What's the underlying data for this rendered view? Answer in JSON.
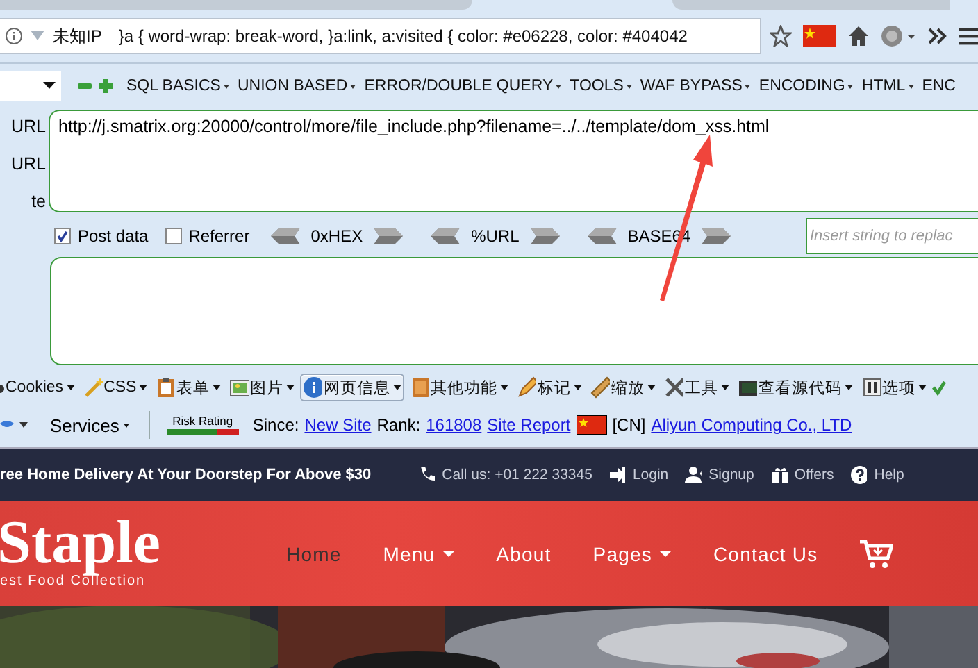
{
  "browser": {
    "ip_label": "未知IP",
    "address_text": "}a { word-wrap: break-word, }a:link, a:visited { color: #e06228, color: #404042"
  },
  "hackbar": {
    "menus": [
      {
        "label": "SQL BASICS",
        "has_menu": true
      },
      {
        "label": "UNION BASED",
        "has_menu": true
      },
      {
        "label": "ERROR/DOUBLE QUERY",
        "has_menu": true
      },
      {
        "label": "TOOLS",
        "has_menu": true
      },
      {
        "label": "WAF BYPASS",
        "has_menu": true
      },
      {
        "label": "ENCODING",
        "has_menu": true
      },
      {
        "label": "HTML",
        "has_menu": true
      },
      {
        "label": "ENC",
        "has_menu": false
      }
    ],
    "side_buttons": [
      "URL",
      "URL",
      "te"
    ],
    "url": "http://j.smatrix.org:20000/control/more/file_include.php?filename=../../template/dom_xss.html",
    "options": [
      {
        "label": "Post data",
        "checked": true
      },
      {
        "label": "Referrer",
        "checked": false
      }
    ],
    "encoders": [
      "0xHEX",
      "%URL",
      "BASE64"
    ],
    "replace_placeholder": "Insert string to replac"
  },
  "devbar": {
    "items": [
      {
        "label": "Cookies",
        "selected": false
      },
      {
        "label": "CSS",
        "selected": false
      },
      {
        "label": "表单",
        "selected": false
      },
      {
        "label": "图片",
        "selected": false
      },
      {
        "label": "网页信息",
        "selected": true
      },
      {
        "label": "其他功能",
        "selected": false
      },
      {
        "label": "标记",
        "selected": false
      },
      {
        "label": "缩放",
        "selected": false
      },
      {
        "label": "工具",
        "selected": false
      },
      {
        "label": "查看源代码",
        "selected": false
      },
      {
        "label": "选项",
        "selected": false
      }
    ]
  },
  "services": {
    "label": "Services",
    "risk_label": "Risk Rating",
    "since_label": "Since:",
    "since_link": "New Site",
    "rank_label": "Rank:",
    "rank_link": "161808",
    "report_link": "Site Report",
    "country": "[CN]",
    "host_link": "Aliyun Computing Co., LTD"
  },
  "site": {
    "promo": "ree Home Delivery At Your Doorstep For Above $30",
    "top_links": [
      {
        "label": "Call us: +01 222 33345"
      },
      {
        "label": "Login"
      },
      {
        "label": "Signup"
      },
      {
        "label": "Offers"
      },
      {
        "label": "Help"
      }
    ],
    "logo": "Staple",
    "tagline": "est Food Collection",
    "nav": [
      {
        "label": "Home",
        "selected": true,
        "dropdown": false
      },
      {
        "label": "Menu",
        "selected": false,
        "dropdown": true
      },
      {
        "label": "About",
        "selected": false,
        "dropdown": false
      },
      {
        "label": "Pages",
        "selected": false,
        "dropdown": true
      },
      {
        "label": "Contact Us",
        "selected": false,
        "dropdown": false
      }
    ]
  }
}
